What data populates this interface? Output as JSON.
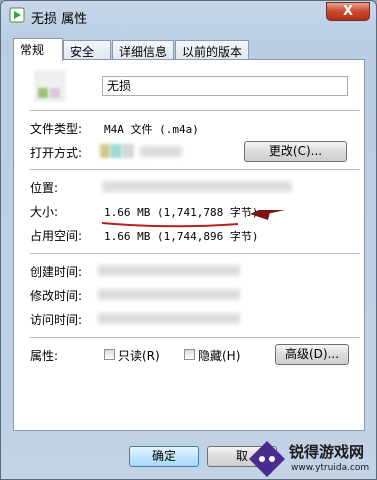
{
  "window": {
    "title": "无损 属性",
    "close_glyph": "X"
  },
  "tabs": [
    {
      "label": "常规"
    },
    {
      "label": "安全"
    },
    {
      "label": "详细信息"
    },
    {
      "label": "以前的版本"
    }
  ],
  "general": {
    "file_name": "无损",
    "file_type_label": "文件类型:",
    "file_type_value": "M4A 文件 (.m4a)",
    "opens_with_label": "打开方式:",
    "change_button": "更改(C)...",
    "location_label": "位置:",
    "size_label": "大小:",
    "size_value": "1.66 MB (1,741,788 字节)",
    "size_on_disk_label": "占用空间:",
    "size_on_disk_value": "1.66 MB (1,744,896 字节)",
    "created_label": "创建时间:",
    "modified_label": "修改时间:",
    "accessed_label": "访问时间:",
    "attributes_label": "属性:",
    "readonly_label": "只读(R)",
    "hidden_label": "隐藏(H)",
    "advanced_button": "高级(D)..."
  },
  "footer": {
    "ok_button": "确定",
    "cancel_button": "取"
  },
  "watermark": {
    "brand": "锐得游戏网",
    "url": "www.ytruida.com"
  },
  "colors": {
    "annotation": "#b51f1f",
    "arrow": "#7a1414"
  }
}
